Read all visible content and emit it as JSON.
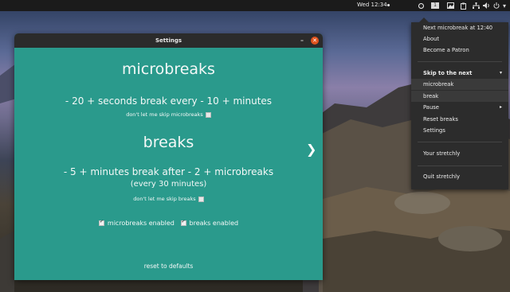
{
  "topbar": {
    "clock": "Wed 12:34",
    "workspace": "1",
    "icons": [
      "stretchly-icon",
      "workspace-icon",
      "image-icon",
      "clipboard-icon",
      "network-icon",
      "volume-icon",
      "power-icon",
      "chevron-down-icon"
    ]
  },
  "window": {
    "title": "Settings",
    "minimize": "–",
    "close": "✕",
    "microbreaks_heading": "microbreaks",
    "microbreaks_line": "- 20 + seconds break every - 10 + minutes",
    "microbreaks_noskip": "don't let me skip microbreaks",
    "breaks_heading": "breaks",
    "breaks_line": "- 5 + minutes break after - 2 + microbreaks",
    "breaks_every": "(every 30 minutes)",
    "breaks_noskip": "don't let me skip breaks",
    "microbreaks_enabled": "microbreaks enabled",
    "breaks_enabled": "breaks enabled",
    "next": "❯",
    "reset": "reset to defaults"
  },
  "menu": {
    "next_microbreak": "Next microbreak at 12:40",
    "about": "About",
    "patron": "Become a Patron",
    "skip_to_next": "Skip to the next",
    "skip_arrow": "▾",
    "skip_microbreak": "microbreak",
    "skip_break": "break",
    "pause": "Pause",
    "pause_arrow": "▸",
    "reset_breaks": "Reset breaks",
    "settings": "Settings",
    "your_stretchly": "Your stretchly",
    "quit": "Quit stretchly"
  },
  "colors": {
    "window_bg": "#2a9a8c",
    "close_button": "#e0531e",
    "menu_bg": "#2c2c2c"
  }
}
